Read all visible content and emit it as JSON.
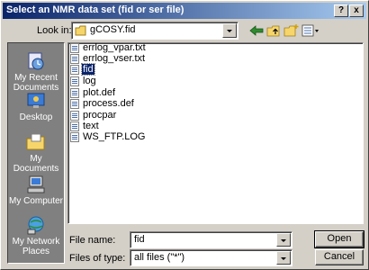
{
  "window": {
    "title": "Select an NMR data set (fid or ser file)",
    "help_label": "?",
    "close_label": "x"
  },
  "lookin": {
    "label": "Look in:",
    "value": "gCOSY.fid"
  },
  "places": [
    {
      "label": "My Recent Documents",
      "icon": "recent-documents-icon"
    },
    {
      "label": "Desktop",
      "icon": "desktop-icon"
    },
    {
      "label": "My Documents",
      "icon": "my-documents-icon"
    },
    {
      "label": "My Computer",
      "icon": "my-computer-icon"
    },
    {
      "label": "My Network Places",
      "icon": "network-places-icon"
    }
  ],
  "files": [
    {
      "name": "errlog_vpar.txt"
    },
    {
      "name": "errlog_vser.txt"
    },
    {
      "name": "fid",
      "selected": true
    },
    {
      "name": "log"
    },
    {
      "name": "plot.def"
    },
    {
      "name": "process.def"
    },
    {
      "name": "procpar"
    },
    {
      "name": "text"
    },
    {
      "name": "WS_FTP.LOG"
    }
  ],
  "filename": {
    "label": "File name:",
    "value": "fid"
  },
  "filetype": {
    "label": "Files of type:",
    "value": "all files (\"*\")"
  },
  "buttons": {
    "open": "Open",
    "cancel": "Cancel"
  },
  "colors": {
    "titlebar_start": "#0a246a",
    "titlebar_end": "#a6caf0",
    "selection": "#0a246a",
    "face": "#d4d0c8"
  }
}
